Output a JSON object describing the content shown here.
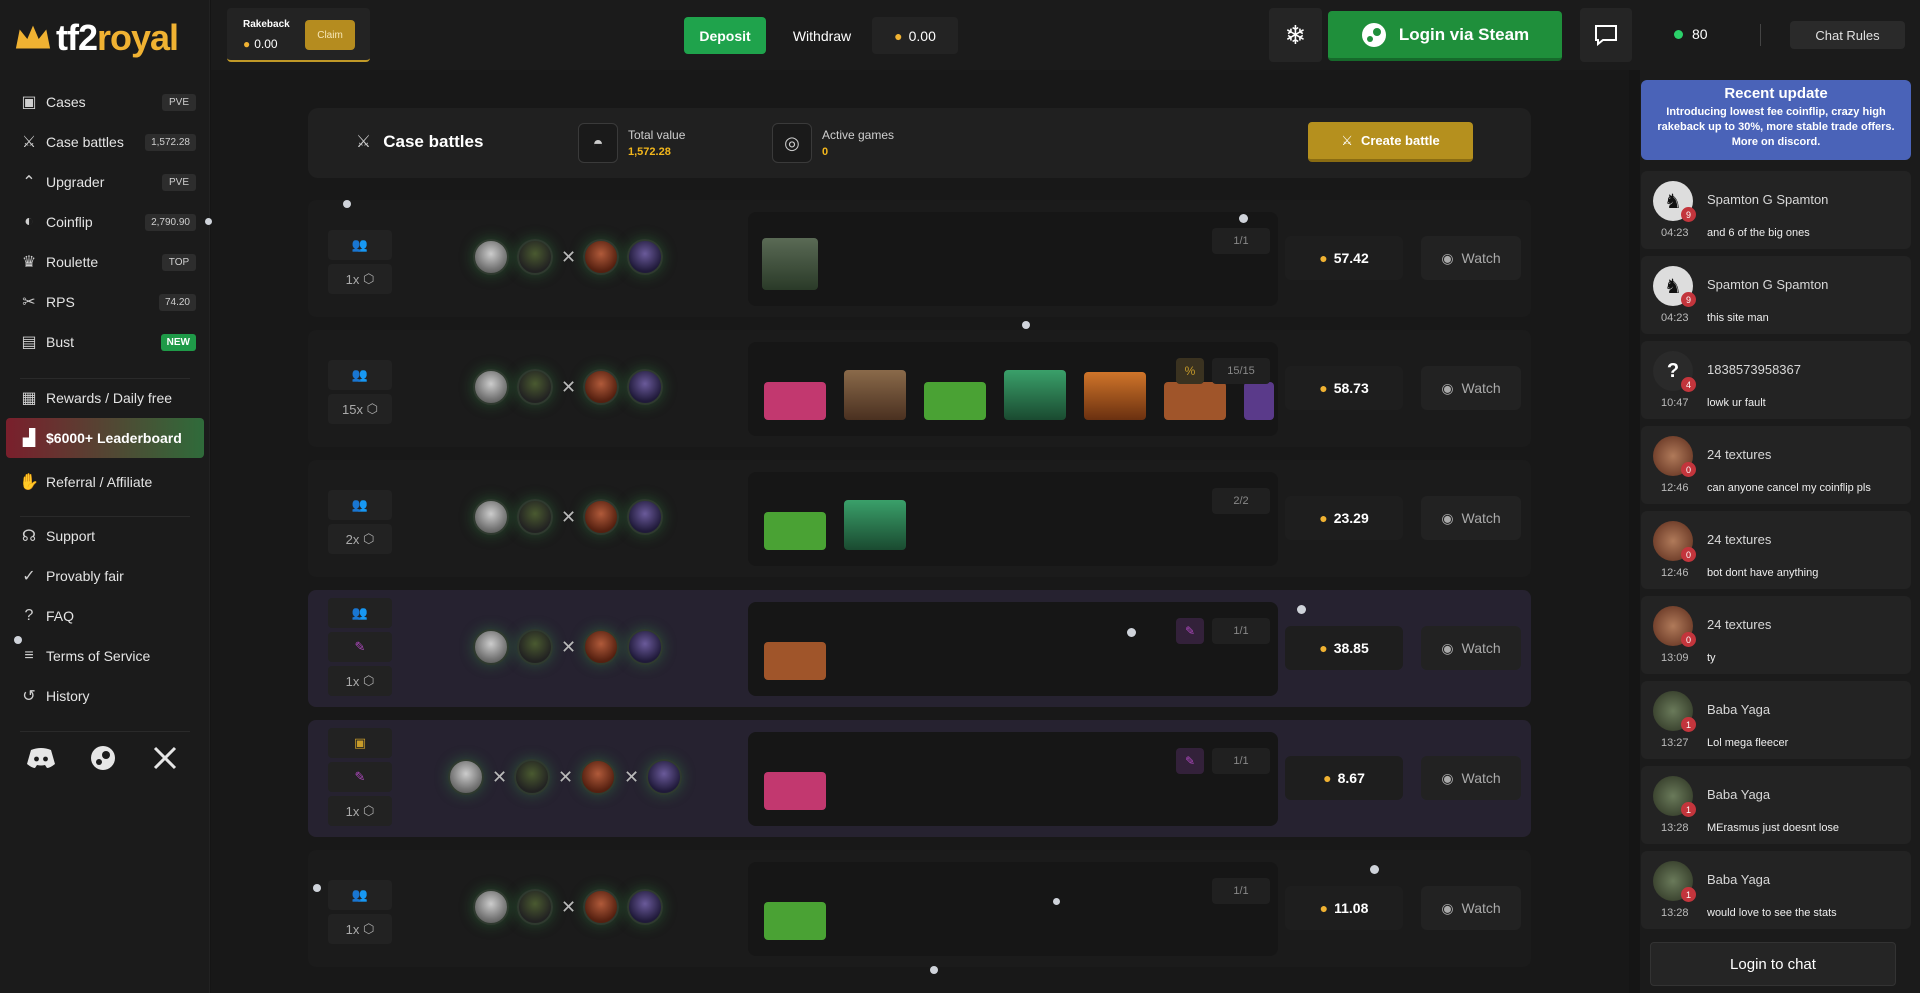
{
  "brand": {
    "name_part1": "tf2",
    "name_part2": "royal"
  },
  "sidebar": {
    "items": [
      {
        "label": "Cases",
        "badge": "PVE",
        "icon": "box-icon"
      },
      {
        "label": "Case battles",
        "badge": "1,572.28",
        "icon": "battle-icon"
      },
      {
        "label": "Upgrader",
        "badge": "PVE",
        "icon": "upgrade-icon"
      },
      {
        "label": "Coinflip",
        "badge": "2,790.90",
        "icon": "coin-icon"
      },
      {
        "label": "Roulette",
        "badge": "TOP",
        "icon": "crown-icon"
      },
      {
        "label": "RPS",
        "badge": "74.20",
        "icon": "rps-icon"
      },
      {
        "label": "Bust",
        "badge": "NEW",
        "icon": "bust-icon"
      }
    ],
    "rewards": "Rewards / Daily free",
    "leaderboard": "$6000+ Leaderboard",
    "referral": "Referral / Affiliate",
    "support": "Support",
    "provably_fair": "Provably fair",
    "faq": "FAQ",
    "tos": "Terms of Service",
    "history": "History"
  },
  "header": {
    "rakeback_title": "Rakeback",
    "rakeback_value": "0.00",
    "claim": "Claim",
    "deposit": "Deposit",
    "withdraw": "Withdraw",
    "balance": "0.00",
    "login": "Login via Steam"
  },
  "chat_header": {
    "online": "80",
    "rules": "Chat Rules"
  },
  "battles_bar": {
    "title": "Case battles",
    "total_label": "Total value",
    "total_value": "1,572.28",
    "active_label": "Active games",
    "active_value": "0",
    "create": "Create battle"
  },
  "battles": [
    {
      "count": "1x",
      "round": "1/1",
      "price": "57.42",
      "watch": "Watch"
    },
    {
      "count": "15x",
      "round": "15/15",
      "price": "58.73",
      "watch": "Watch"
    },
    {
      "count": "2x",
      "round": "2/2",
      "price": "23.29",
      "watch": "Watch"
    },
    {
      "count": "1x",
      "round": "1/1",
      "price": "38.85",
      "watch": "Watch"
    },
    {
      "count": "1x",
      "round": "1/1",
      "price": "8.67",
      "watch": "Watch"
    },
    {
      "count": "1x",
      "round": "1/1",
      "price": "11.08",
      "watch": "Watch"
    }
  ],
  "chat": {
    "update_title": "Recent update",
    "update_body": "Introducing lowest fee coinflip, crazy high rakeback up to 30%, more stable trade offers. More on discord.",
    "messages": [
      {
        "name": "Spamton G Spamton",
        "level": "9",
        "time": "04:23",
        "text": "and 6 of the big ones"
      },
      {
        "name": "Spamton G Spamton",
        "level": "9",
        "time": "04:23",
        "text": "this site man"
      },
      {
        "name": "1838573958367",
        "level": "4",
        "time": "10:47",
        "text": "lowk ur fault",
        "avatar_char": "?"
      },
      {
        "name": "24 textures",
        "level": "0",
        "time": "12:46",
        "text": "can anyone cancel my coinflip pls"
      },
      {
        "name": "24 textures",
        "level": "0",
        "time": "12:46",
        "text": "bot dont have anything"
      },
      {
        "name": "24 textures",
        "level": "0",
        "time": "13:09",
        "text": "ty"
      },
      {
        "name": "Baba Yaga",
        "level": "1",
        "time": "13:27",
        "text": "Lol mega fleecer"
      },
      {
        "name": "Baba Yaga",
        "level": "1",
        "time": "13:28",
        "text": "MErasmus just doesnt lose"
      },
      {
        "name": "Baba Yaga",
        "level": "1",
        "time": "13:28",
        "text": "would love to see the stats"
      }
    ],
    "login": "Login to chat"
  },
  "colors": {
    "accent_gold": "#f0b232",
    "deposit_green": "#1fa34c",
    "steam_green": "#1f8f3b",
    "update_blue": "#4a63b8"
  }
}
